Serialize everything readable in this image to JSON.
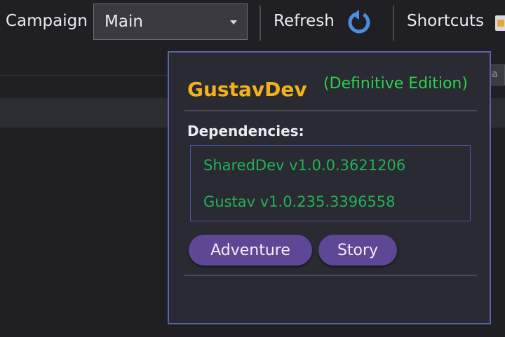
{
  "toolbar": {
    "campaign_label": "Campaign",
    "campaign_value": "Main",
    "refresh_label": "Refresh",
    "shortcuts_label": "Shortcuts"
  },
  "side_panel": {
    "peek_text": "a"
  },
  "popup": {
    "title": "GustavDev",
    "edition": "(Definitive Edition)",
    "dependencies_label": "Dependencies:",
    "dependencies": [
      "SharedDev v1.0.0.3621206",
      "Gustav v1.0.235.3396558"
    ],
    "tags": [
      "Adventure",
      "Story"
    ]
  },
  "colors": {
    "title": "#f2b21c",
    "edition": "#2cd14a",
    "dependency": "#22b257",
    "tag_bg": "#5e4795",
    "popup_border": "#5a62a8",
    "refresh_icon": "#4a90e2"
  },
  "icons": {
    "refresh": "refresh-icon",
    "shortcuts": "shortcut-icon",
    "dropdown": "chevron-down-icon"
  }
}
